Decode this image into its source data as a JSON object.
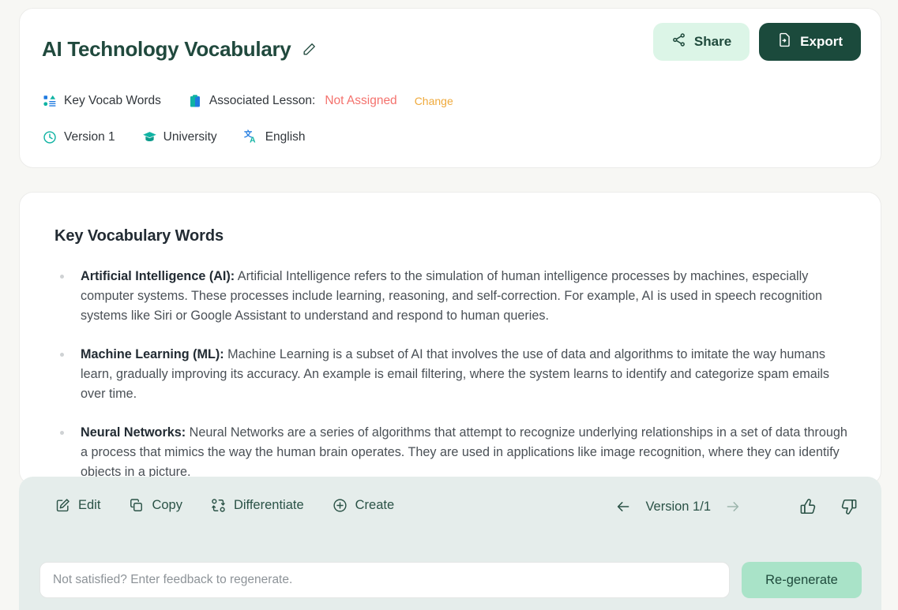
{
  "header": {
    "title": "AI Technology Vocabulary",
    "edit_icon": "pencil-icon",
    "share_label": "Share",
    "share_icon": "share-nodes-icon",
    "export_label": "Export",
    "export_icon": "file-export-icon",
    "meta": {
      "doc_type_label": "Key Vocab Words",
      "doc_type_icon": "vocab-list-icon",
      "lesson_label": "Associated Lesson:",
      "lesson_icon": "clipboard-icon",
      "lesson_value": "Not Assigned",
      "lesson_change_label": "Change",
      "version_label": "Version 1",
      "version_icon": "clock-icon",
      "level_label": "University",
      "level_icon": "graduation-cap-icon",
      "language_label": "English",
      "language_icon": "translate-icon"
    }
  },
  "content": {
    "heading": "Key Vocabulary Words",
    "items": [
      {
        "term": "Artificial Intelligence (AI):",
        "definition": " Artificial Intelligence refers to the simulation of human intelligence processes by machines, especially computer systems. These processes include learning, reasoning, and self-correction. For example, AI is used in speech recognition systems like Siri or Google Assistant to understand and respond to human queries."
      },
      {
        "term": "Machine Learning (ML):",
        "definition": " Machine Learning is a subset of AI that involves the use of data and algorithms to imitate the way humans learn, gradually improving its accuracy. An example is email filtering, where the system learns to identify and categorize spam emails over time."
      },
      {
        "term": "Neural Networks:",
        "definition": " Neural Networks are a series of algorithms that attempt to recognize underlying relationships in a set of data through a process that mimics the way the human brain operates. They are used in applications like image recognition, where they can identify objects in a picture."
      }
    ]
  },
  "toolbar": {
    "edit_label": "Edit",
    "edit_icon": "pencil-square-icon",
    "copy_label": "Copy",
    "copy_icon": "copy-icon",
    "differentiate_label": "Differentiate",
    "differentiate_icon": "shuffle-icon",
    "create_label": "Create",
    "create_icon": "plus-circle-icon",
    "prev_icon": "arrow-left-icon",
    "next_icon": "arrow-right-icon",
    "version_label": "Version 1/1",
    "thumbs_up_icon": "thumbs-up-icon",
    "thumbs_down_icon": "thumbs-down-icon"
  },
  "regenerate": {
    "placeholder": "Not satisfied? Enter feedback to regenerate.",
    "value": "",
    "button_label": "Re-generate"
  },
  "colors": {
    "page_bg": "#f7f7f4",
    "card_bg": "#ffffff",
    "brand_dark_green": "#1b4a3c",
    "brand_mint": "#dcf5e7",
    "toolbar_bg": "#e5edeb",
    "regen_btn": "#a9e3c8",
    "warn_red": "#f4726d",
    "warn_amber": "#efa93b",
    "teal": "#10b3a3",
    "blue": "#1f7ae0"
  }
}
